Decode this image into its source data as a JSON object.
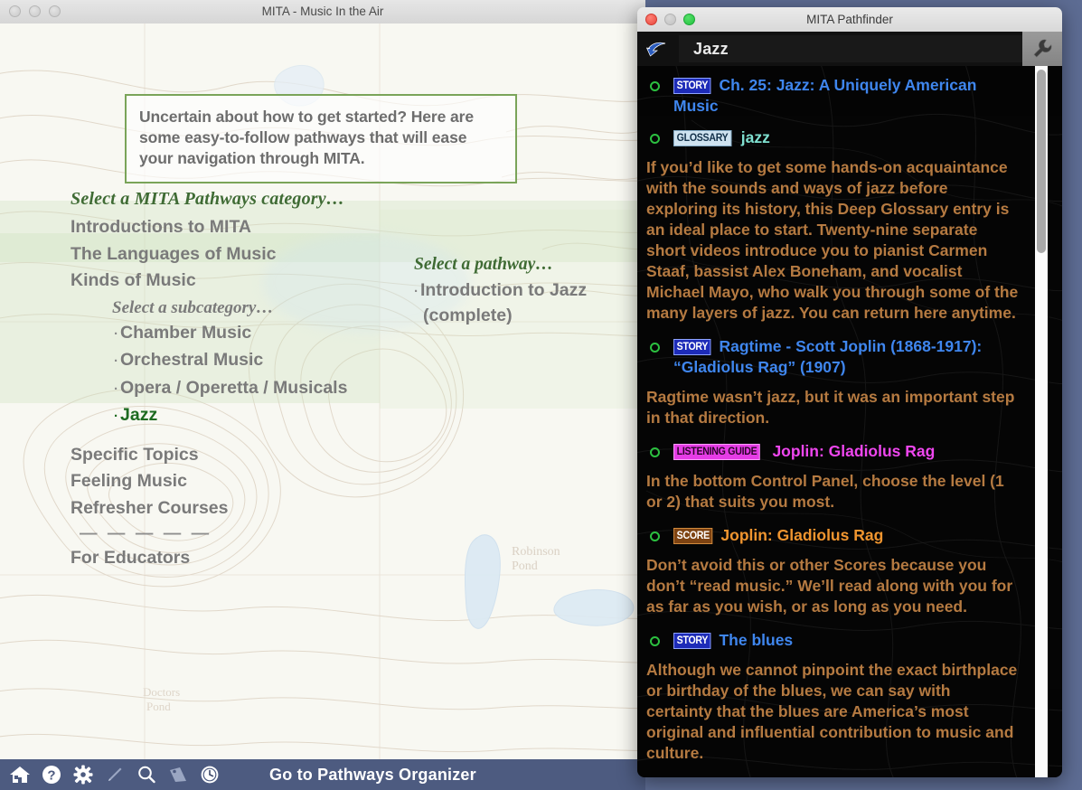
{
  "mita_window": {
    "title": "MITA - Music In the Air",
    "traffic_lights": [
      "close-inactive",
      "minimize-inactive",
      "zoom-inactive"
    ],
    "intro_box": {
      "text": "Uncertain about how to get started? Here are some easy-to-follow pathways that will ease your navigation through MITA."
    },
    "category_panel": {
      "heading": "Select a MITA Pathways category…",
      "items": [
        {
          "label": "Introductions to MITA",
          "active": false
        },
        {
          "label": "The Languages of Music",
          "active": false
        },
        {
          "label": "Kinds of Music",
          "active": false
        }
      ],
      "sub_heading": "Select a subcategory…",
      "sub_items": [
        {
          "label": "Chamber Music",
          "active": false
        },
        {
          "label": "Orchestral Music",
          "active": false
        },
        {
          "label": "Opera / Operetta / Musicals",
          "active": false
        },
        {
          "label": "Jazz",
          "active": true
        }
      ],
      "items_after": [
        {
          "label": "Specific Topics",
          "active": false
        },
        {
          "label": "Feeling Music",
          "active": false
        },
        {
          "label": "Refresher Courses",
          "active": false
        }
      ],
      "divider": "— — — — —",
      "items_last": [
        {
          "label": "For Educators",
          "active": false
        }
      ]
    },
    "pathway_panel": {
      "heading": "Select a pathway…",
      "items": [
        {
          "label": "Introduction to Jazz",
          "note": "(complete)"
        }
      ]
    },
    "toolbar": {
      "icons": [
        "home-icon",
        "help-icon",
        "gear-icon",
        "pencil-icon",
        "search-icon",
        "bookmark-icon",
        "clock-icon"
      ],
      "label": "Go to Pathways Organizer",
      "background_color": "#4d5b80"
    }
  },
  "pathfinder_window": {
    "title": "MITA Pathfinder",
    "traffic_lights": [
      "close",
      "minimize",
      "zoom"
    ],
    "navbar": {
      "back_icon": "back-arrow-icon",
      "breadcrumb": "Jazz",
      "tool_icon": "wrench-icon"
    },
    "entries": [
      {
        "kind": "story",
        "badge": "STORY",
        "title": "Ch. 25: Jazz: A Uniquely American Music",
        "bullet": true
      },
      {
        "kind": "glossary",
        "badge": "GLOSSARY",
        "title": "jazz",
        "bullet": true
      },
      {
        "kind": "description",
        "text": "If you’d like to get some hands-on acquaintance with the sounds and ways of jazz before exploring its history, this Deep Glossary entry is an ideal place to start. Twenty-nine separate short videos introduce you to pianist Carmen Staaf, bassist Alex Boneham, and vocalist Michael Mayo, who walk you through some of the many layers of jazz. You can return here anytime."
      },
      {
        "kind": "story",
        "badge": "STORY",
        "title": "Ragtime - Scott Joplin (1868-1917): “Gladiolus Rag” (1907)",
        "bullet": true
      },
      {
        "kind": "description",
        "text": "Ragtime wasn’t jazz, but it was an important step in that direction."
      },
      {
        "kind": "listening",
        "badge": "LISTENING GUIDE",
        "title": "Joplin: Gladiolus Rag",
        "bullet": true
      },
      {
        "kind": "description",
        "text": "In the bottom Control Panel, choose the level (1 or 2) that suits you most."
      },
      {
        "kind": "score",
        "badge": "SCORE",
        "title": "Joplin: Gladiolus Rag",
        "bullet": true
      },
      {
        "kind": "description",
        "text": "Don’t avoid this or other Scores because you don’t “read music.” We’ll read along with you for as far as you wish, or as long as you need."
      },
      {
        "kind": "story",
        "badge": "STORY",
        "title": "The blues",
        "bullet": true
      },
      {
        "kind": "description",
        "text": "Although we cannot pinpoint the exact birthplace or birthday of the blues, we can say with certainty that the blues are America’s most original and influential contribution to music and culture."
      }
    ],
    "colors": {
      "story_badge_bg": "#1d2bb8",
      "story_title": "#3f86ee",
      "glossary_badge_bg": "#cfe3f0",
      "glossary_title": "#7fe0d0",
      "listening_badge_bg": "#e63ce6",
      "listening_title": "#ef46ef",
      "score_badge_bg": "#7e4312",
      "score_title": "#f0952f",
      "description_text": "#b57a41",
      "bullet_ring": "#2cc040",
      "panel_bg": "#050505"
    }
  },
  "map_labels": {
    "pond": "Robinson Pond",
    "pond2": "Doctors Pond"
  }
}
